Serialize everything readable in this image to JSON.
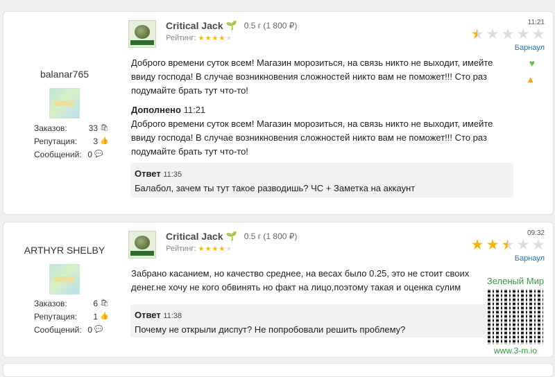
{
  "reviews": [
    {
      "user": {
        "name": "balanar765",
        "orders_label": "Заказов:",
        "orders": "33",
        "reputation_label": "Репутация:",
        "reputation": "3",
        "messages_label": "Сообщений:",
        "messages": "0"
      },
      "product": {
        "name": "Critical Jack",
        "qty": "0.5 г (1 800 ₽)",
        "rating_label": "Рейтинг:",
        "rating_stars": 4
      },
      "time": "11:21",
      "score": 0.5,
      "city": "Барнаул",
      "text": "Доброго времени суток всем! Магазин морозиться, на связь никто не выходит, имейте ввиду господа! В случае возникновения сложностей никто вам не поможет!!! Сто раз подумайте брать тут что-то!",
      "added": {
        "label": "Дополнено",
        "time": "11:21",
        "text": "Доброго времени суток всем! Магазин морозиться, на связь никто не выходит, имейте ввиду господа! В случае возникновения сложностей никто вам не поможет!!! Сто раз подумайте брать тут что-то!"
      },
      "reply": {
        "label": "Ответ",
        "time": "11:35",
        "text": "Балабол, зачем ты тут такое разводишь? ЧС + Заметка на аккаунт"
      }
    },
    {
      "user": {
        "name": "ARTHYR SHELBY",
        "orders_label": "Заказов:",
        "orders": "6",
        "reputation_label": "Репутация:",
        "reputation": "1",
        "messages_label": "Сообщений:",
        "messages": "0"
      },
      "product": {
        "name": "Critical Jack",
        "qty": "0.5 г (1 800 ₽)",
        "rating_label": "Рейтинг:",
        "rating_stars": 4
      },
      "time": "09:32",
      "score": 2.5,
      "city": "Барнаул",
      "text": "Забрано касанием, но качество среднее, на весах было 0.25, это не стоит своих денег.не хочу не кого обвинять но факт на лицо,поэтому такая и оценка сулим",
      "reply": {
        "label": "Ответ",
        "time": "11:38",
        "text": "Почему не открыли диспут? Не попробовали решить проблему?"
      }
    }
  ],
  "watermark": {
    "title": "Зеленый Мир",
    "url": "www.3-m.io"
  }
}
